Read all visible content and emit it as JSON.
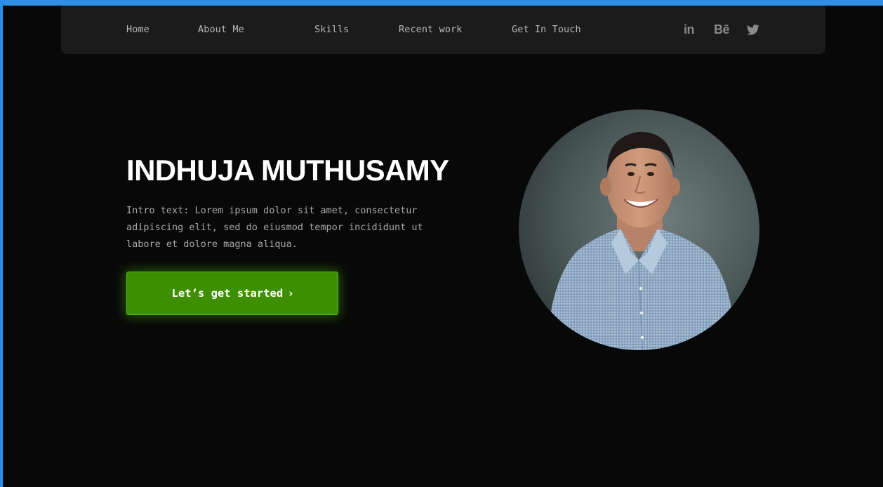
{
  "nav": {
    "items": [
      {
        "label": "Home"
      },
      {
        "label": "About Me"
      },
      {
        "label": "Skills"
      },
      {
        "label": "Recent work"
      },
      {
        "label": "Get In Touch"
      }
    ],
    "social": [
      {
        "icon": "linkedin-icon",
        "text": "in"
      },
      {
        "icon": "behance-icon",
        "text": "Bē"
      },
      {
        "icon": "twitter-icon"
      }
    ]
  },
  "hero": {
    "title": "INDHUJA MUTHUSAMY",
    "intro": "Intro text: Lorem ipsum dolor sit amet, consectetur adipiscing elit, sed do eiusmod tempor incididunt ut labore et dolore magna aliqua.",
    "cta_label": "Let’s get started",
    "cta_chevron": "›"
  },
  "colors": {
    "accent": "#3e8f00",
    "background": "#080808",
    "navbar": "#1b1b1b",
    "frame_border": "#2f8fe6"
  }
}
